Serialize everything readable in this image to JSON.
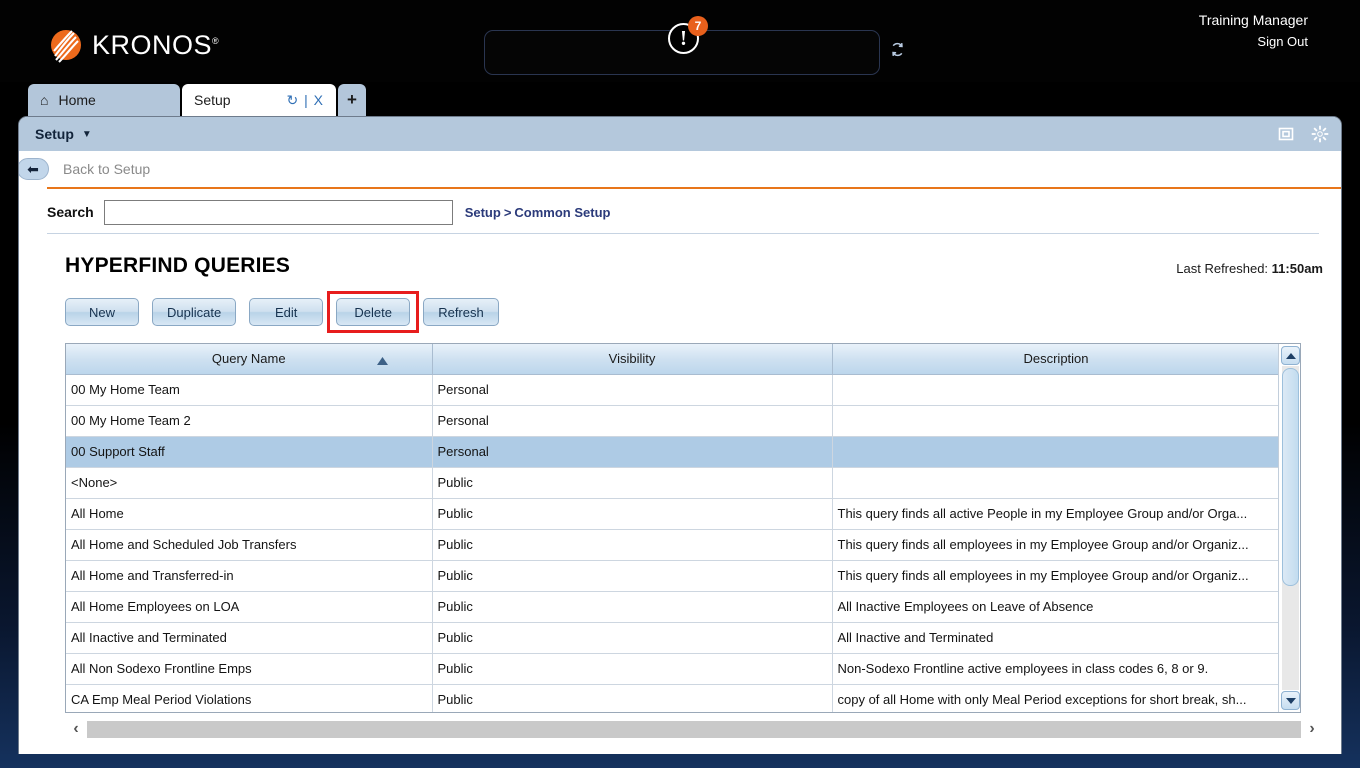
{
  "header": {
    "logo_text": "KRONOS",
    "logo_icon": "kronos-logo-icon",
    "alert_icon": "alert-exclamation-icon",
    "alert_count": "7",
    "refresh_icon": "refresh-icon",
    "user_name": "Training Manager",
    "sign_out": "Sign Out"
  },
  "tabs": [
    {
      "label": "Home",
      "icon": "home-icon",
      "active": false
    },
    {
      "label": "Setup",
      "active": true,
      "refresh_glyph": "↻",
      "close_glyph": "X"
    }
  ],
  "add_tab_label": "+",
  "panel": {
    "title": "Setup",
    "caret": "▼",
    "maximize_icon": "maximize-icon",
    "settings_icon": "gear-icon",
    "back_label": "Back to Setup",
    "back_icon": "back-arrow-icon"
  },
  "search": {
    "label": "Search",
    "value": "",
    "placeholder": ""
  },
  "breadcrumb": {
    "root": "Setup",
    "separator": ">",
    "current": "Common Setup"
  },
  "page": {
    "title": "HYPERFIND QUERIES",
    "last_refreshed_label": "Last Refreshed:",
    "last_refreshed_time": "11:50am"
  },
  "toolbar": {
    "buttons": [
      {
        "label": "New",
        "highlighted": false
      },
      {
        "label": "Duplicate",
        "highlighted": false
      },
      {
        "label": "Edit",
        "highlighted": false
      },
      {
        "label": "Delete",
        "highlighted": true
      },
      {
        "label": "Refresh",
        "highlighted": false
      }
    ],
    "highlight_color": "#e71d1d"
  },
  "table": {
    "columns": [
      {
        "label": "Query Name",
        "sorted": "asc",
        "sort_icon": "sort-asc-icon"
      },
      {
        "label": "Visibility",
        "sorted": null
      },
      {
        "label": "Description",
        "sorted": null
      }
    ],
    "rows": [
      {
        "name": "00 My Home Team",
        "visibility": "Personal",
        "description": "",
        "selected": false
      },
      {
        "name": "00 My Home Team 2",
        "visibility": "Personal",
        "description": "",
        "selected": false
      },
      {
        "name": "00 Support Staff",
        "visibility": "Personal",
        "description": "",
        "selected": true
      },
      {
        "name": "<None>",
        "visibility": "Public",
        "description": "",
        "selected": false
      },
      {
        "name": "All Home",
        "visibility": "Public",
        "description": "This query finds all active People in my Employee Group and/or Orga...",
        "selected": false
      },
      {
        "name": "All Home and Scheduled Job Transfers",
        "visibility": "Public",
        "description": "This query finds all employees in my Employee Group and/or Organiz...",
        "selected": false
      },
      {
        "name": "All Home and Transferred-in",
        "visibility": "Public",
        "description": "This query finds all employees in my Employee Group and/or Organiz...",
        "selected": false
      },
      {
        "name": "All Home Employees on LOA",
        "visibility": "Public",
        "description": "All Inactive Employees on Leave of Absence",
        "selected": false
      },
      {
        "name": "All Inactive and Terminated",
        "visibility": "Public",
        "description": "All Inactive and Terminated",
        "selected": false
      },
      {
        "name": "All Non Sodexo Frontline Emps",
        "visibility": "Public",
        "description": "Non-Sodexo Frontline active employees in class codes 6, 8 or 9.",
        "selected": false
      },
      {
        "name": "CA Emp Meal Period Violations",
        "visibility": "Public",
        "description": "copy of all Home with only Meal Period exceptions for short break, sh...",
        "selected": false
      }
    ],
    "selected_row_color": "#aecbe5"
  },
  "scrollbars": {
    "vertical": {
      "up_icon": "scroll-up-icon",
      "down_icon": "scroll-down-icon"
    },
    "horizontal": {
      "left_icon": "scroll-left-icon",
      "right_icon": "scroll-right-icon",
      "left_glyph": "‹",
      "right_glyph": "›"
    }
  }
}
